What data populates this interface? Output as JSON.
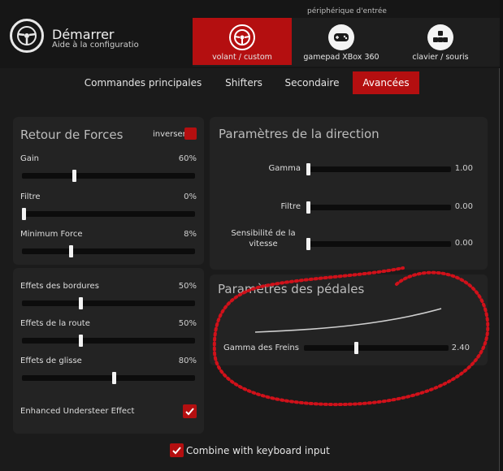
{
  "header": {
    "title": "Démarrer",
    "subtitle": "Aide à la configuratio",
    "device_title": "périphérique d'entrée",
    "devices": [
      {
        "label": "volant / custom",
        "icon": "steering-wheel-icon",
        "active": true
      },
      {
        "label": "gamepad XBox 360",
        "icon": "gamepad-icon",
        "active": false
      },
      {
        "label": "clavier / souris",
        "icon": "keyboard-icon",
        "active": false
      }
    ]
  },
  "tabs": [
    {
      "label": "Commandes principales",
      "active": false
    },
    {
      "label": "Shifters",
      "active": false
    },
    {
      "label": "Secondaire",
      "active": false
    },
    {
      "label": "Avancées",
      "active": true
    }
  ],
  "ffb": {
    "title": "Retour de Forces",
    "invert_label": "inverser",
    "invert_checked": true,
    "sliders": [
      {
        "label": "Gain",
        "value": "60%",
        "level": 0.3
      },
      {
        "label": "Filtre",
        "value": "0%",
        "level": 0.0
      },
      {
        "label": "Minimum Force",
        "value": "8%",
        "level": 0.28
      }
    ]
  },
  "effects": {
    "sliders": [
      {
        "label": "Effets des bordures",
        "value": "50%",
        "level": 0.34
      },
      {
        "label": "Effets de la route",
        "value": "50%",
        "level": 0.34
      },
      {
        "label": "Effets de glisse",
        "value": "80%",
        "level": 0.53
      }
    ],
    "understeer_label": "Enhanced Understeer Effect",
    "understeer_checked": true
  },
  "steering": {
    "title": "Paramètres de la direction",
    "sliders": [
      {
        "label": "Gamma",
        "value": "1.00",
        "level": 0.0
      },
      {
        "label": "Filtre",
        "value": "0.00",
        "level": 0.0
      },
      {
        "label": "Sensibilité de la vitesse",
        "value": "0.00",
        "level": 0.0
      }
    ]
  },
  "pedals": {
    "title": "Paramètres des pédales",
    "brake_gamma_label": "Gamma des Freins",
    "brake_gamma_value": "2.40",
    "brake_gamma_level": 0.36
  },
  "combine_label": "Combine with keyboard input",
  "combine_checked": true,
  "colors": {
    "accent": "#b40f10",
    "annotation": "#d0111a"
  }
}
